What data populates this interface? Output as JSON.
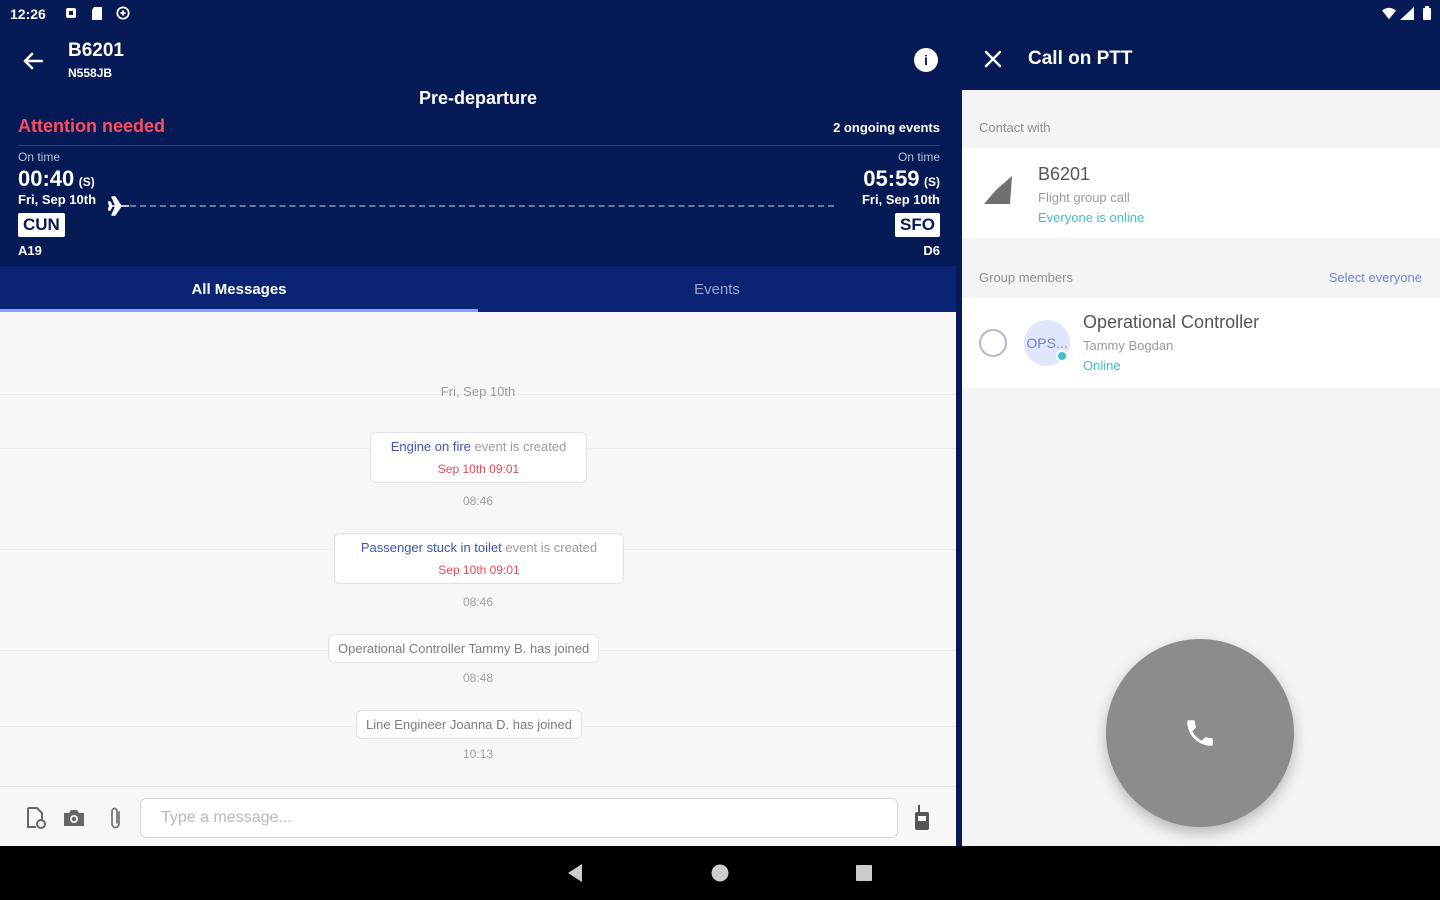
{
  "status_bar": {
    "time": "12:26"
  },
  "flight": {
    "number": "B6201",
    "tail": "N558JB",
    "phase": "Pre-departure",
    "attention": "Attention needed",
    "ongoing_events": "2 ongoing events",
    "info_icon": "i",
    "departure": {
      "status": "On time",
      "time": "00:40",
      "tz": "(S)",
      "date": "Fri, Sep 10th",
      "airport": "CUN",
      "gate": "A19"
    },
    "arrival": {
      "status": "On time",
      "time": "05:59",
      "tz": "(S)",
      "date": "Fri, Sep 10th",
      "airport": "SFO",
      "gate": "D6"
    }
  },
  "tabs": [
    {
      "label": "All Messages"
    },
    {
      "label": "Events"
    }
  ],
  "messages": {
    "date_separator": "Fri, Sep 10th",
    "events": [
      {
        "name": "Engine on fire",
        "suffix": " event is created",
        "time": "Sep 10th 09:01",
        "stamp": "08:46"
      },
      {
        "name": "Passenger stuck in toilet",
        "suffix": " event is created",
        "time": "Sep 10th 09:01",
        "stamp": "08:46"
      }
    ],
    "system": [
      {
        "text": "Operational Controller Tammy B. has joined",
        "stamp": "08:48"
      },
      {
        "text": "Line Engineer Joanna D. has joined",
        "stamp": "10:13"
      }
    ]
  },
  "composer": {
    "placeholder": "Type a message..."
  },
  "ptt": {
    "title": "Call on PTT",
    "contact_label": "Contact with",
    "contact": {
      "name": "B6201",
      "sub": "Flight group call",
      "status": "Everyone is online"
    },
    "group_label": "Group members",
    "select_everyone": "Select everyone",
    "member": {
      "avatar": "OPS...",
      "role": "Operational Controller",
      "name": "Tammy Bogdan",
      "status": "Online"
    }
  },
  "colors": {
    "navy": "#061a55",
    "alert": "#ff4d5e",
    "online": "#3ec0c6",
    "link": "#6b85d6"
  }
}
